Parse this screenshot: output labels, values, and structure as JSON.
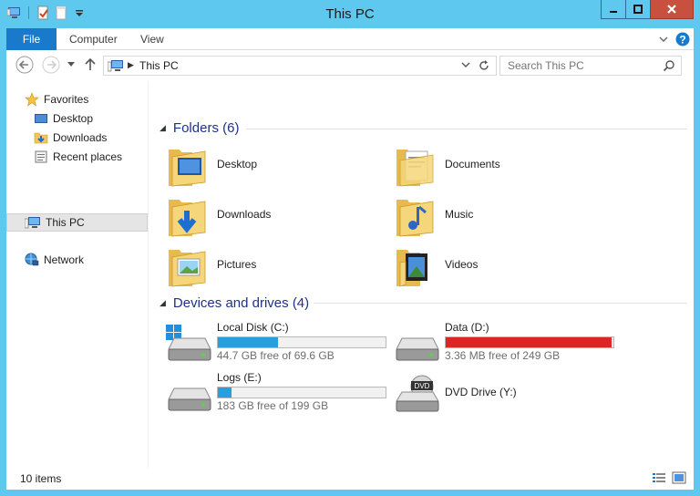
{
  "window": {
    "title": "This PC"
  },
  "ribbon": {
    "tabs": [
      {
        "label": "File"
      },
      {
        "label": "Computer"
      },
      {
        "label": "View"
      }
    ]
  },
  "address": {
    "path": "This PC",
    "search_placeholder": "Search This PC"
  },
  "nav": {
    "favorites_label": "Favorites",
    "favorites": [
      {
        "label": "Desktop"
      },
      {
        "label": "Downloads"
      },
      {
        "label": "Recent places"
      }
    ],
    "this_pc_label": "This PC",
    "network_label": "Network"
  },
  "folders": {
    "header": "Folders (6)",
    "items": [
      {
        "label": "Desktop",
        "icon": "desktop-folder-icon"
      },
      {
        "label": "Documents",
        "icon": "documents-folder-icon"
      },
      {
        "label": "Downloads",
        "icon": "downloads-folder-icon"
      },
      {
        "label": "Music",
        "icon": "music-folder-icon"
      },
      {
        "label": "Pictures",
        "icon": "pictures-folder-icon"
      },
      {
        "label": "Videos",
        "icon": "videos-folder-icon"
      }
    ]
  },
  "drives": {
    "header": "Devices and drives (4)",
    "items": [
      {
        "label": "Local Disk (C:)",
        "free": "44.7 GB free of 69.6 GB",
        "used_fraction": 0.36,
        "bar_color": "#26a0da"
      },
      {
        "label": "Data (D:)",
        "free": "3.36 MB free of 249 GB",
        "used_fraction": 0.99,
        "bar_color": "#da2626"
      },
      {
        "label": "Logs (E:)",
        "free": "183 GB free of 199 GB",
        "used_fraction": 0.08,
        "bar_color": "#26a0da"
      },
      {
        "label": "DVD Drive (Y:)"
      }
    ]
  },
  "status": {
    "item_count": "10 items"
  },
  "colors": {
    "accent": "#1979ca",
    "frame": "#5ec8ee",
    "close_button": "#c7503f"
  }
}
